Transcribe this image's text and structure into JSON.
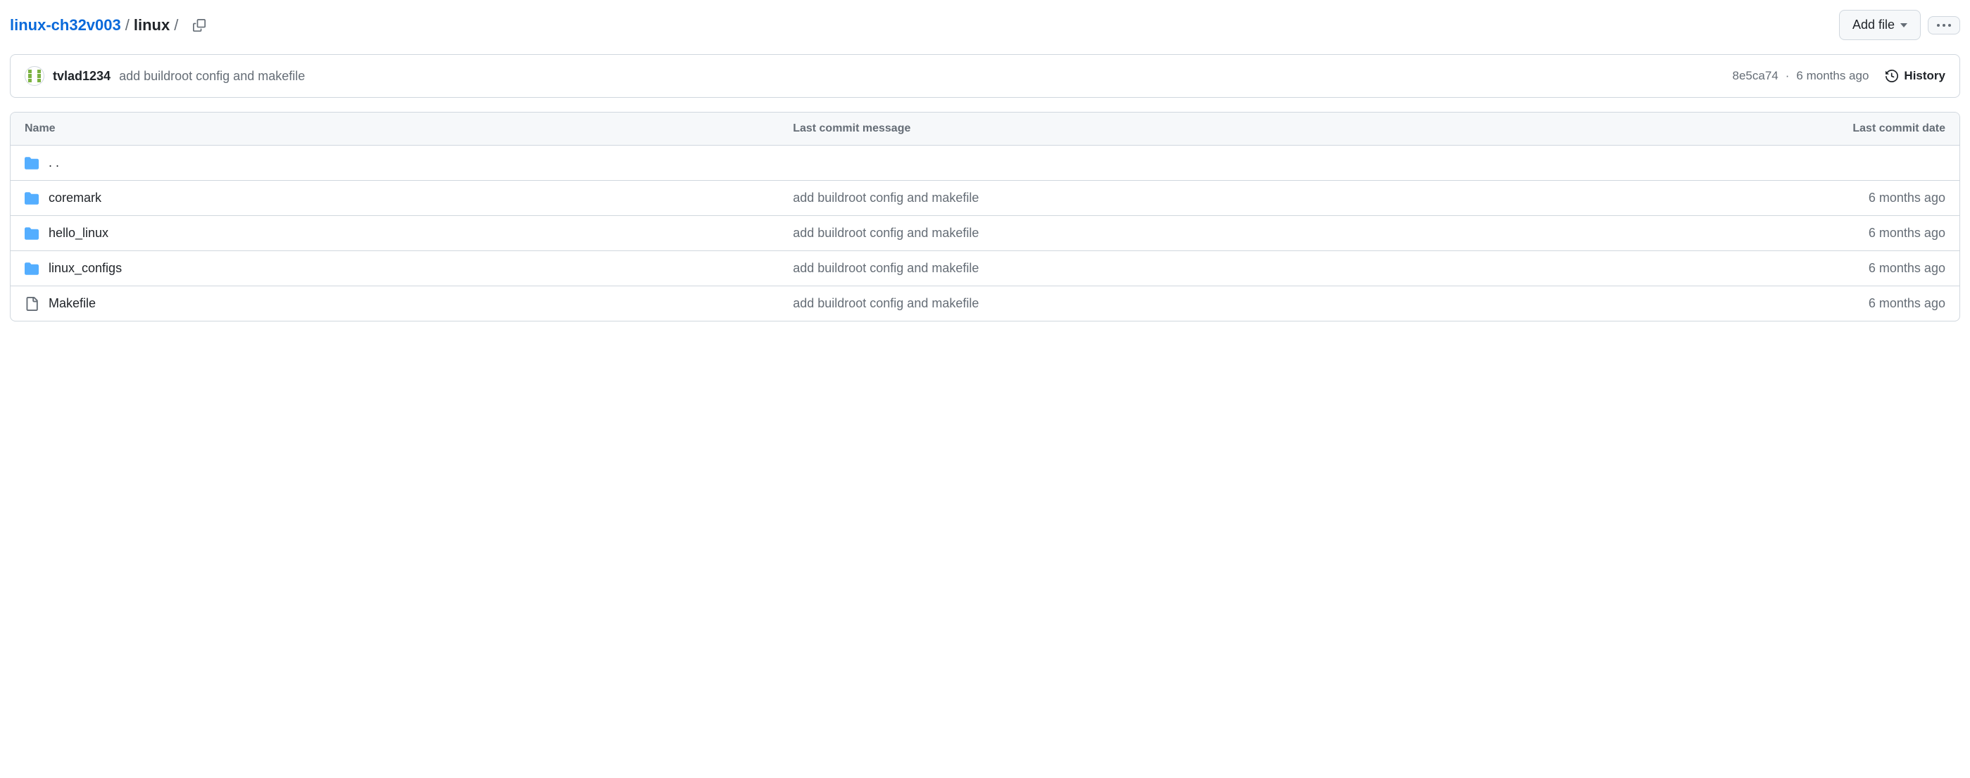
{
  "breadcrumb": {
    "repo": "linux-ch32v003",
    "current": "linux",
    "sep": "/"
  },
  "actions": {
    "add_file": "Add file"
  },
  "commit": {
    "author": "tvlad1234",
    "message": "add buildroot config and makefile",
    "sha": "8e5ca74",
    "sep": "·",
    "time": "6 months ago",
    "history": "History"
  },
  "table": {
    "headers": {
      "name": "Name",
      "msg": "Last commit message",
      "date": "Last commit date"
    },
    "parent": ". .",
    "rows": [
      {
        "type": "folder",
        "name": "coremark",
        "msg": "add buildroot config and makefile",
        "date": "6 months ago"
      },
      {
        "type": "folder",
        "name": "hello_linux",
        "msg": "add buildroot config and makefile",
        "date": "6 months ago"
      },
      {
        "type": "folder",
        "name": "linux_configs",
        "msg": "add buildroot config and makefile",
        "date": "6 months ago"
      },
      {
        "type": "file",
        "name": "Makefile",
        "msg": "add buildroot config and makefile",
        "date": "6 months ago"
      }
    ]
  }
}
